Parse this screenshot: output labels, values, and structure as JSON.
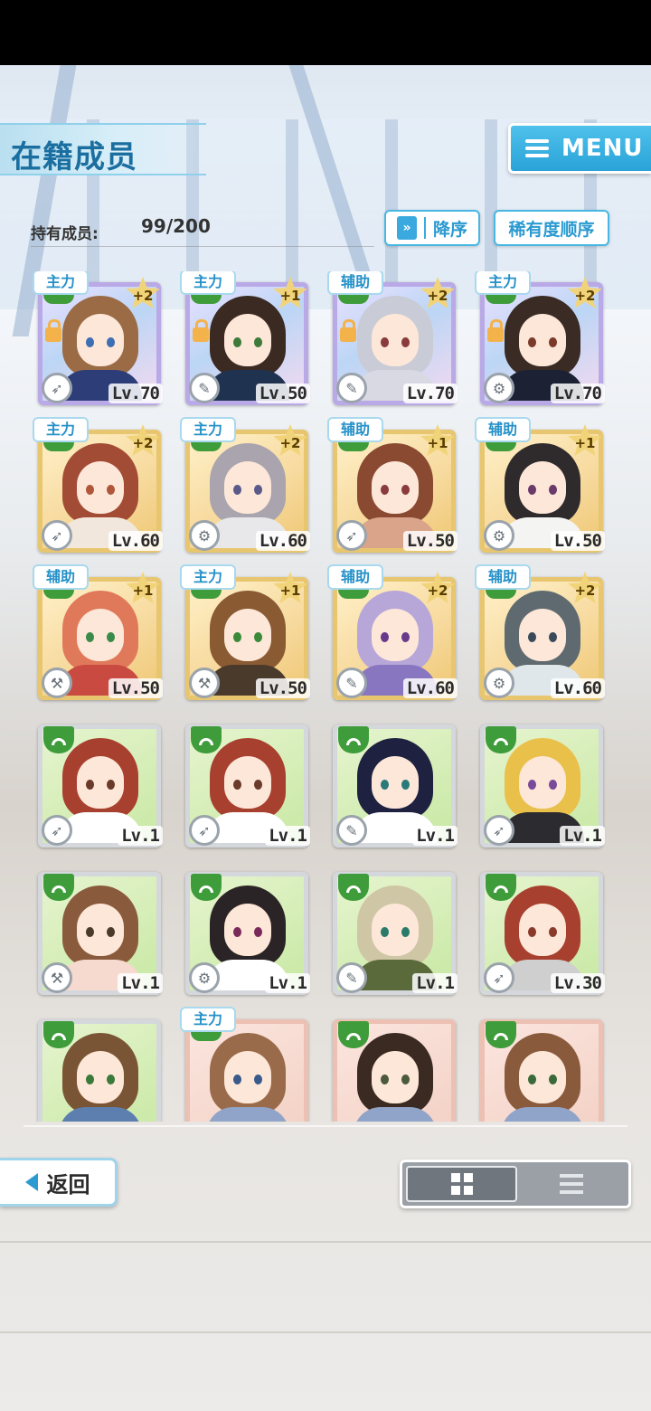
{
  "header": {
    "title": "在籍成员",
    "menu_label": "MENU"
  },
  "member_count": {
    "label": "持有成员:",
    "value": "99/200"
  },
  "sort": {
    "order_label": "降序",
    "order_icon": "chevron-double-down-icon",
    "rarity_label": "稀有度顺序"
  },
  "colors": {
    "accent": "#2aa3d8",
    "role_tag_text": "#2691c9",
    "shield_green": "#3f9c3a"
  },
  "cards": [
    {
      "role": "主力",
      "bonus": "+2",
      "level": "Lv.70",
      "weapon_icon": "rocket-icon",
      "locked": true,
      "rarity": "rainbow"
    },
    {
      "role": "主力",
      "bonus": "+1",
      "level": "Lv.50",
      "weapon_icon": "wrench-icon",
      "locked": true,
      "rarity": "rainbow"
    },
    {
      "role": "辅助",
      "bonus": "+2",
      "level": "Lv.70",
      "weapon_icon": "wrench-icon",
      "locked": true,
      "rarity": "rainbow"
    },
    {
      "role": "主力",
      "bonus": "+2",
      "level": "Lv.70",
      "weapon_icon": "gear-icon",
      "locked": true,
      "rarity": "rainbow"
    },
    {
      "role": "主力",
      "bonus": "+2",
      "level": "Lv.60",
      "weapon_icon": "rocket-icon",
      "locked": false,
      "rarity": "gold"
    },
    {
      "role": "主力",
      "bonus": "+2",
      "level": "Lv.60",
      "weapon_icon": "gear-icon",
      "locked": false,
      "rarity": "gold"
    },
    {
      "role": "辅助",
      "bonus": "+1",
      "level": "Lv.50",
      "weapon_icon": "rocket-icon",
      "locked": false,
      "rarity": "gold"
    },
    {
      "role": "辅助",
      "bonus": "+1",
      "level": "Lv.50",
      "weapon_icon": "gear-icon",
      "locked": false,
      "rarity": "gold"
    },
    {
      "role": "辅助",
      "bonus": "+1",
      "level": "Lv.50",
      "weapon_icon": "hammer-icon",
      "locked": false,
      "rarity": "gold"
    },
    {
      "role": "主力",
      "bonus": "+1",
      "level": "Lv.50",
      "weapon_icon": "hammer-icon",
      "locked": false,
      "rarity": "gold"
    },
    {
      "role": "辅助",
      "bonus": "+2",
      "level": "Lv.60",
      "weapon_icon": "wrench-icon",
      "locked": false,
      "rarity": "gold"
    },
    {
      "role": "辅助",
      "bonus": "+2",
      "level": "Lv.60",
      "weapon_icon": "gear-icon",
      "locked": false,
      "rarity": "gold"
    },
    {
      "role": "",
      "bonus": "",
      "level": "Lv.1",
      "weapon_icon": "rocket-icon",
      "locked": false,
      "rarity": "silver"
    },
    {
      "role": "",
      "bonus": "",
      "level": "Lv.1",
      "weapon_icon": "rocket-icon",
      "locked": false,
      "rarity": "silver"
    },
    {
      "role": "",
      "bonus": "",
      "level": "Lv.1",
      "weapon_icon": "wrench-icon",
      "locked": false,
      "rarity": "silver"
    },
    {
      "role": "",
      "bonus": "",
      "level": "Lv.1",
      "weapon_icon": "rocket-icon",
      "locked": false,
      "rarity": "silver"
    },
    {
      "role": "",
      "bonus": "",
      "level": "Lv.1",
      "weapon_icon": "hammer-icon",
      "locked": false,
      "rarity": "silver"
    },
    {
      "role": "",
      "bonus": "",
      "level": "Lv.1",
      "weapon_icon": "gear-icon",
      "locked": false,
      "rarity": "silver"
    },
    {
      "role": "",
      "bonus": "",
      "level": "Lv.1",
      "weapon_icon": "wrench-icon",
      "locked": false,
      "rarity": "silver"
    },
    {
      "role": "",
      "bonus": "",
      "level": "Lv.30",
      "weapon_icon": "rocket-icon",
      "locked": false,
      "rarity": "silver"
    },
    {
      "role": "",
      "bonus": "",
      "level": "",
      "weapon_icon": "",
      "locked": false,
      "rarity": "silver"
    },
    {
      "role": "主力",
      "bonus": "",
      "level": "",
      "weapon_icon": "",
      "locked": false,
      "rarity": "pink"
    },
    {
      "role": "",
      "bonus": "",
      "level": "",
      "weapon_icon": "",
      "locked": false,
      "rarity": "pink"
    },
    {
      "role": "",
      "bonus": "",
      "level": "",
      "weapon_icon": "",
      "locked": false,
      "rarity": "pink"
    }
  ],
  "footer": {
    "back_label": "返回",
    "view_grid_icon": "grid-view-icon",
    "view_list_icon": "list-view-icon"
  }
}
